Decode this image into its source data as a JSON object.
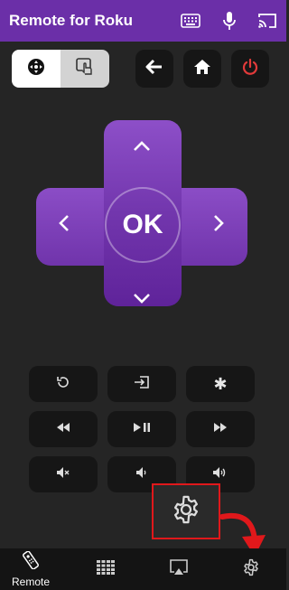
{
  "app": {
    "title": "Remote for Roku"
  },
  "toolbar_icons": [
    "keyboard-icon",
    "microphone-icon",
    "cast-icon"
  ],
  "mode_toggle": {
    "options": [
      "dpad-mode-icon",
      "touchpad-mode-icon"
    ],
    "selected": "dpad-mode-icon"
  },
  "top_buttons": [
    "back-arrow-icon",
    "home-icon",
    "power-icon"
  ],
  "dpad": {
    "ok_label": "OK"
  },
  "key_grid": [
    [
      "replay-icon",
      "input-icon",
      "asterisk-icon"
    ],
    [
      "rewind-icon",
      "play-pause-icon",
      "fast-forward-icon"
    ],
    [
      "mute-icon",
      "volume-down-icon",
      "volume-up-icon"
    ]
  ],
  "asterisk_label": "✱",
  "bottom_nav": {
    "items": [
      {
        "icon": "remote-icon",
        "label": "Remote",
        "active": true
      },
      {
        "icon": "grid-icon"
      },
      {
        "icon": "screen-mirror-icon"
      },
      {
        "icon": "settings-icon"
      }
    ]
  },
  "colors": {
    "appbar": "#6b2fa8",
    "dpad": "#7a3db5",
    "power": "#e23a3a",
    "highlight": "#e0181b",
    "background": "#252525"
  }
}
